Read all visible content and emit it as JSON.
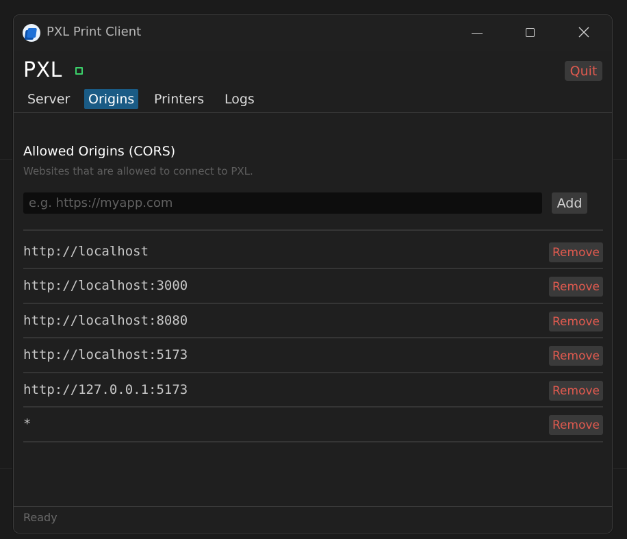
{
  "window": {
    "title": "PXL Print Client"
  },
  "header": {
    "brand": "PXL",
    "quit_label": "Quit"
  },
  "tabs": [
    {
      "label": "Server",
      "active": false
    },
    {
      "label": "Origins",
      "active": true
    },
    {
      "label": "Printers",
      "active": false
    },
    {
      "label": "Logs",
      "active": false
    }
  ],
  "origins_panel": {
    "title": "Allowed Origins (CORS)",
    "description": "Websites that are allowed to connect to PXL.",
    "input_value": "",
    "input_placeholder": "e.g. https://myapp.com",
    "add_label": "Add",
    "remove_label": "Remove",
    "origins": [
      "http://localhost",
      "http://localhost:3000",
      "http://localhost:8080",
      "http://localhost:5173",
      "http://127.0.0.1:5173",
      "*"
    ]
  },
  "status": {
    "text": "Ready"
  },
  "colors": {
    "accent_tab": "#1a5b85",
    "status_indicator": "#3bd06a",
    "danger_text": "#e05a4f"
  },
  "icons": {
    "app": "printer-app-icon",
    "minimize": "minimize-icon",
    "maximize": "maximize-icon",
    "close": "close-icon"
  }
}
